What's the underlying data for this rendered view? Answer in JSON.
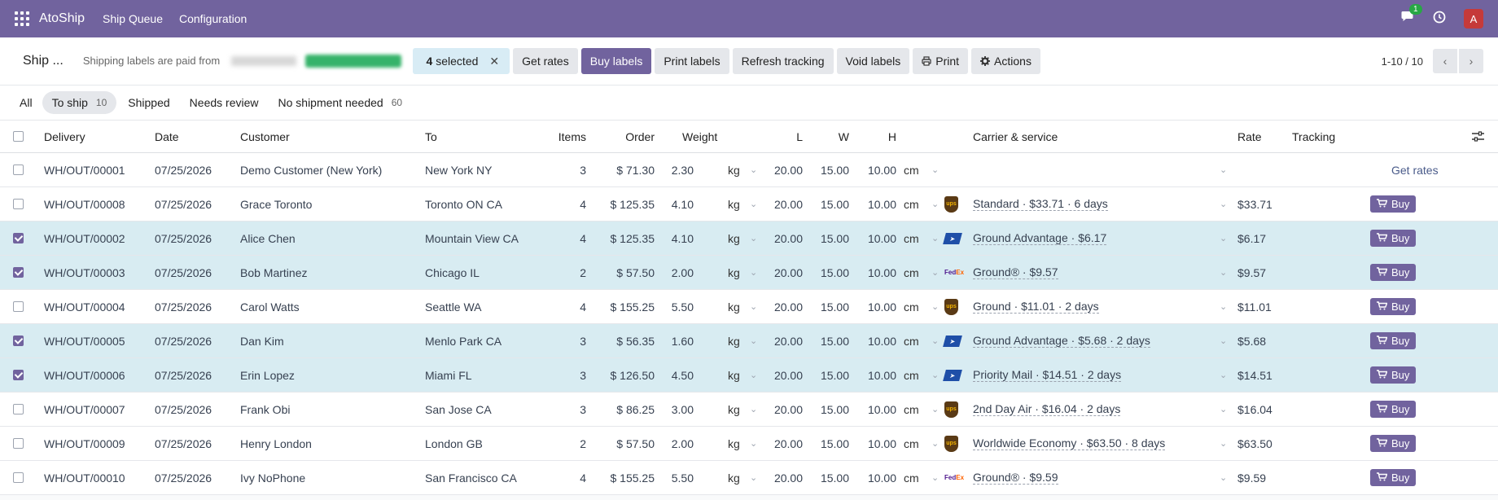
{
  "topbar": {
    "brand": "AtoShip",
    "menus": [
      "Ship Queue",
      "Configuration"
    ],
    "chat_badge": "1",
    "avatar_letter": "A"
  },
  "controlbar": {
    "breadcrumb": "Ship ...",
    "paid_note": "Shipping labels are paid from",
    "selection_count": "4",
    "selection_label": "selected",
    "buttons": {
      "get_rates": "Get rates",
      "buy_labels": "Buy labels",
      "print_labels": "Print labels",
      "refresh_tracking": "Refresh tracking",
      "void_labels": "Void labels",
      "print": "Print",
      "actions": "Actions"
    },
    "pager": "1-10 / 10"
  },
  "tabs": [
    {
      "label": "All",
      "count": ""
    },
    {
      "label": "To ship",
      "count": "10"
    },
    {
      "label": "Shipped",
      "count": ""
    },
    {
      "label": "Needs review",
      "count": ""
    },
    {
      "label": "No shipment needed",
      "count": "60"
    }
  ],
  "columns": {
    "delivery": "Delivery",
    "date": "Date",
    "customer": "Customer",
    "to": "To",
    "items": "Items",
    "order": "Order",
    "weight": "Weight",
    "l": "L",
    "w": "W",
    "h": "H",
    "carrier": "Carrier & service",
    "rate": "Rate",
    "tracking": "Tracking"
  },
  "units": {
    "weight": "kg",
    "dim": "cm"
  },
  "actions": {
    "get_rates": "Get rates",
    "buy": "Buy"
  },
  "colors": {
    "brand": "#71639e",
    "selected_row": "#d8ecf2"
  },
  "rows": [
    {
      "checked": false,
      "delivery": "WH/OUT/00001",
      "date": "07/25/2026",
      "customer": "Demo Customer (New York)",
      "to": "New York NY",
      "items": "3",
      "order": "$ 71.30",
      "weight": "2.30",
      "l": "20.00",
      "w": "15.00",
      "h": "10.00",
      "carrier": "",
      "service": "",
      "rate": "",
      "action": "get_rates"
    },
    {
      "checked": false,
      "delivery": "WH/OUT/00008",
      "date": "07/25/2026",
      "customer": "Grace Toronto",
      "to": "Toronto ON CA",
      "items": "4",
      "order": "$ 125.35",
      "weight": "4.10",
      "l": "20.00",
      "w": "15.00",
      "h": "10.00",
      "carrier": "ups",
      "service": "Standard · $33.71 · 6 days",
      "rate": "$33.71",
      "action": "buy"
    },
    {
      "checked": true,
      "delivery": "WH/OUT/00002",
      "date": "07/25/2026",
      "customer": "Alice Chen",
      "to": "Mountain View CA",
      "items": "4",
      "order": "$ 125.35",
      "weight": "4.10",
      "l": "20.00",
      "w": "15.00",
      "h": "10.00",
      "carrier": "usps",
      "service": "Ground Advantage · $6.17",
      "rate": "$6.17",
      "action": "buy"
    },
    {
      "checked": true,
      "delivery": "WH/OUT/00003",
      "date": "07/25/2026",
      "customer": "Bob Martinez",
      "to": "Chicago IL",
      "items": "2",
      "order": "$ 57.50",
      "weight": "2.00",
      "l": "20.00",
      "w": "15.00",
      "h": "10.00",
      "carrier": "fedex",
      "service": "Ground® · $9.57",
      "rate": "$9.57",
      "action": "buy"
    },
    {
      "checked": false,
      "delivery": "WH/OUT/00004",
      "date": "07/25/2026",
      "customer": "Carol Watts",
      "to": "Seattle WA",
      "items": "4",
      "order": "$ 155.25",
      "weight": "5.50",
      "l": "20.00",
      "w": "15.00",
      "h": "10.00",
      "carrier": "ups",
      "service": "Ground · $11.01 · 2 days",
      "rate": "$11.01",
      "action": "buy"
    },
    {
      "checked": true,
      "delivery": "WH/OUT/00005",
      "date": "07/25/2026",
      "customer": "Dan Kim",
      "to": "Menlo Park CA",
      "items": "3",
      "order": "$ 56.35",
      "weight": "1.60",
      "l": "20.00",
      "w": "15.00",
      "h": "10.00",
      "carrier": "usps",
      "service": "Ground Advantage · $5.68 · 2 days",
      "rate": "$5.68",
      "action": "buy"
    },
    {
      "checked": true,
      "delivery": "WH/OUT/00006",
      "date": "07/25/2026",
      "customer": "Erin Lopez",
      "to": "Miami FL",
      "items": "3",
      "order": "$ 126.50",
      "weight": "4.50",
      "l": "20.00",
      "w": "15.00",
      "h": "10.00",
      "carrier": "usps",
      "service": "Priority Mail · $14.51 · 2 days",
      "rate": "$14.51",
      "action": "buy"
    },
    {
      "checked": false,
      "delivery": "WH/OUT/00007",
      "date": "07/25/2026",
      "customer": "Frank Obi",
      "to": "San Jose CA",
      "items": "3",
      "order": "$ 86.25",
      "weight": "3.00",
      "l": "20.00",
      "w": "15.00",
      "h": "10.00",
      "carrier": "ups",
      "service": "2nd Day Air · $16.04 · 2 days",
      "rate": "$16.04",
      "action": "buy"
    },
    {
      "checked": false,
      "delivery": "WH/OUT/00009",
      "date": "07/25/2026",
      "customer": "Henry London",
      "to": "London GB",
      "items": "2",
      "order": "$ 57.50",
      "weight": "2.00",
      "l": "20.00",
      "w": "15.00",
      "h": "10.00",
      "carrier": "ups",
      "service": "Worldwide Economy · $63.50 · 8 days",
      "rate": "$63.50",
      "action": "buy"
    },
    {
      "checked": false,
      "delivery": "WH/OUT/00010",
      "date": "07/25/2026",
      "customer": "Ivy NoPhone",
      "to": "San Francisco CA",
      "items": "4",
      "order": "$ 155.25",
      "weight": "5.50",
      "l": "20.00",
      "w": "15.00",
      "h": "10.00",
      "carrier": "fedex",
      "service": "Ground® · $9.59",
      "rate": "$9.59",
      "action": "buy"
    }
  ]
}
